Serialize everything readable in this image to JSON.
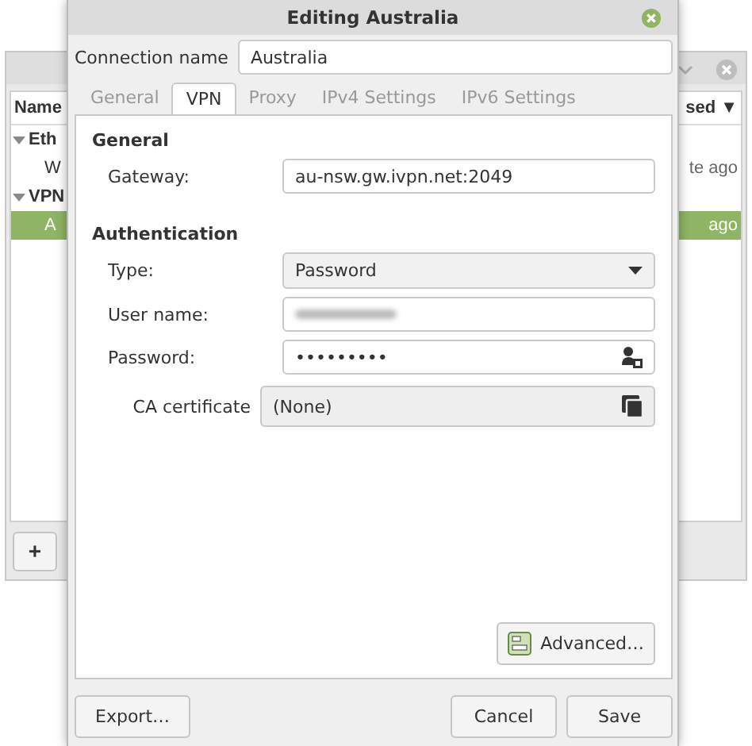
{
  "background_window": {
    "columns": [
      "Name",
      "sed"
    ],
    "sort_indicator": "▼",
    "rows": [
      {
        "kind": "group",
        "label": "Eth",
        "expanded": true,
        "selected": false
      },
      {
        "kind": "item",
        "label": "W",
        "time": "te ago",
        "selected": false
      },
      {
        "kind": "group",
        "label": "VPN",
        "expanded": true,
        "selected": false
      },
      {
        "kind": "item",
        "label": "A",
        "time": "ago",
        "selected": true
      }
    ],
    "add_button": "+"
  },
  "dialog": {
    "title": "Editing Australia",
    "connection_name": {
      "label": "Connection name",
      "value": "Australia"
    },
    "tabs": [
      {
        "label": "General",
        "selected": false
      },
      {
        "label": "VPN",
        "selected": true
      },
      {
        "label": "Proxy",
        "selected": false
      },
      {
        "label": "IPv4 Settings",
        "selected": false
      },
      {
        "label": "IPv6 Settings",
        "selected": false
      }
    ],
    "sections": [
      {
        "heading": "General",
        "fields": [
          {
            "kind": "text",
            "label": "Gateway:",
            "value": "au-nsw.gw.ivpn.net:2049"
          }
        ]
      },
      {
        "heading": "Authentication",
        "fields": [
          {
            "kind": "dropdown",
            "label": "Type:",
            "value": "Password"
          },
          {
            "kind": "blurred",
            "label": "User name:"
          },
          {
            "kind": "password",
            "label": "Password:",
            "value": "•••••••••"
          },
          {
            "kind": "file",
            "label": "CA certificate",
            "value": "(None)"
          }
        ]
      }
    ],
    "advanced_button": "Advanced…",
    "buttons": {
      "export": "Export…",
      "cancel": "Cancel",
      "save": "Save"
    }
  }
}
